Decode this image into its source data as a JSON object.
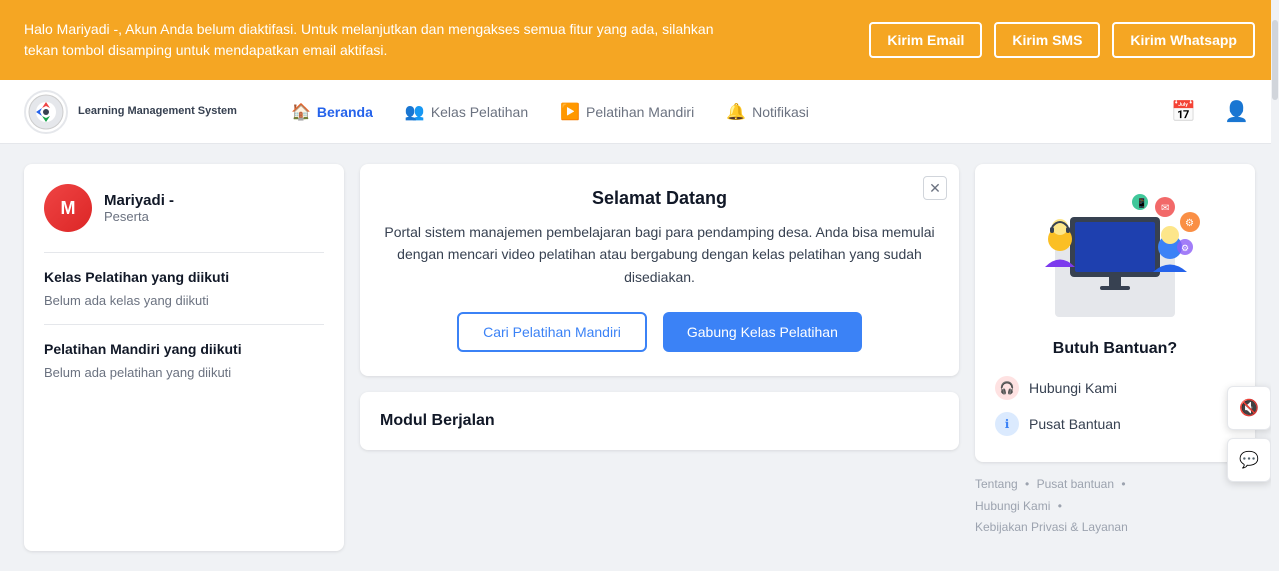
{
  "notif_bar": {
    "message": "Halo Mariyadi -, Akun Anda belum diaktifasi. Untuk melanjutkan dan mengakses semua fitur yang ada, silahkan tekan tombol disamping untuk mendapatkan email aktifasi.",
    "btn_email": "Kirim Email",
    "btn_sms": "Kirim SMS",
    "btn_whatsapp": "Kirim Whatsapp",
    "bg_color": "#F5A623"
  },
  "header": {
    "logo_text": "Learning Management System",
    "nav_items": [
      {
        "label": "Beranda",
        "active": true
      },
      {
        "label": "Kelas Pelatihan",
        "active": false
      },
      {
        "label": "Pelatihan Mandiri",
        "active": false
      },
      {
        "label": "Notifikasi",
        "active": false
      }
    ]
  },
  "left_sidebar": {
    "user_name": "Mariyadi -",
    "user_role": "Peserta",
    "section_kelas_title": "Kelas Pelatihan yang diikuti",
    "section_kelas_empty": "Belum ada kelas yang diikuti",
    "section_mandiri_title": "Pelatihan Mandiri yang diikuti",
    "section_mandiri_empty": "Belum ada pelatihan yang diikuti"
  },
  "welcome_card": {
    "title": "Selamat Datang",
    "description": "Portal sistem manajemen pembelajaran bagi para pendamping desa. Anda bisa memulai dengan mencari video pelatihan atau bergabung dengan kelas pelatihan yang sudah disediakan.",
    "btn_cari": "Cari Pelatihan Mandiri",
    "btn_gabung": "Gabung Kelas Pelatihan"
  },
  "modul_section": {
    "title": "Modul Berjalan"
  },
  "right_sidebar": {
    "help_title": "Butuh Bantuan?",
    "hubungi_kami": "Hubungi Kami",
    "pusat_bantuan": "Pusat Bantuan",
    "footer": {
      "tentang": "Tentang",
      "pusat_bantuan": "Pusat bantuan",
      "hubungi_kami": "Hubungi Kami",
      "kebijakan": "Kebijakan Privasi & Layanan"
    }
  },
  "float_buttons": {
    "mute_icon": "🔇",
    "chat_icon": "💬"
  }
}
